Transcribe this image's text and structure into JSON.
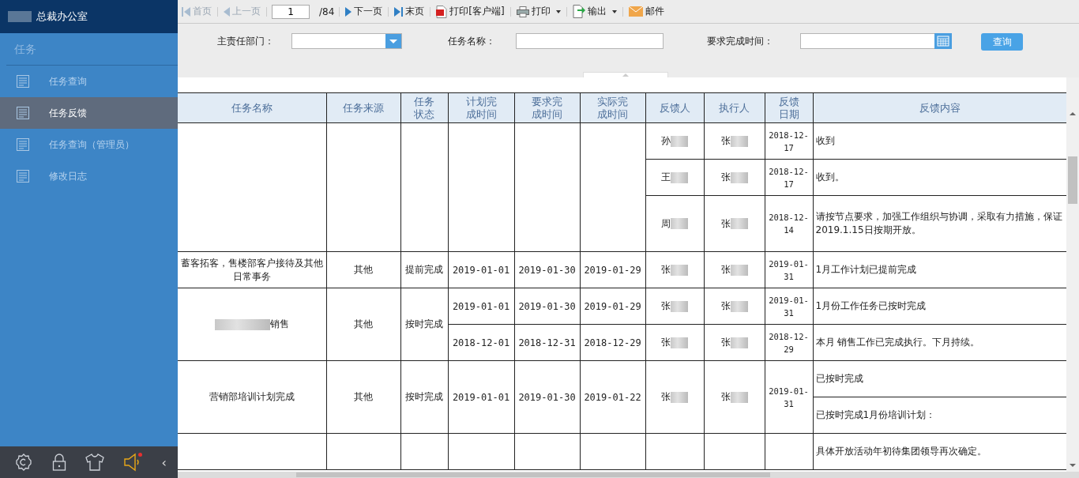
{
  "sidebar": {
    "header": {
      "title": "总裁办公室",
      "redacted": true
    },
    "section": "任务",
    "items": [
      {
        "label": "任务查询",
        "selected": false
      },
      {
        "label": "任务反馈",
        "selected": true
      },
      {
        "label": "任务查询（管理员）",
        "selected": false
      },
      {
        "label": "修改日志",
        "selected": false
      }
    ],
    "footer": {
      "collapse": "‹",
      "notification": true
    }
  },
  "toolbar": [
    {
      "kind": "first",
      "label": "首页",
      "disabled": true
    },
    {
      "kind": "prev",
      "label": "上一页",
      "disabled": true
    },
    {
      "kind": "page",
      "value": "1",
      "total": "/84"
    },
    {
      "kind": "next",
      "label": "下一页",
      "disabled": false
    },
    {
      "kind": "last",
      "label": "末页",
      "disabled": false
    },
    {
      "kind": "pdf",
      "label": "打印[客户端]"
    },
    {
      "kind": "print",
      "label": "打印",
      "dropdown": true
    },
    {
      "kind": "export",
      "label": "输出",
      "dropdown": true
    },
    {
      "kind": "mail",
      "label": "邮件"
    }
  ],
  "filters": [
    {
      "kind": "select",
      "label": "主责任部门："
    },
    {
      "kind": "text",
      "label": "任务名称："
    },
    {
      "kind": "date",
      "label": "要求完成时间："
    }
  ],
  "search_button": "查询",
  "table": {
    "columns": [
      "任务名称",
      "任务来源",
      "任务状态",
      "计划完成时间",
      "要求完成时间",
      "实际完成时间",
      "反馈人",
      "执行人",
      "反馈日期",
      "反馈内容"
    ],
    "tasks": [
      {
        "records": [
          {
            "feedbacks": [
              {
                "person": "孙",
                "executor": "张",
                "redacted": true,
                "date": "2018-12-17",
                "contents": [
                  "收到"
                ]
              },
              {
                "person": "王",
                "executor": "张",
                "redacted": true,
                "date": "2018-12-17",
                "contents": [
                  "收到。"
                ]
              },
              {
                "person": "周",
                "executor": "张",
                "redacted": true,
                "date": "2018-12-14",
                "contents": [
                  "请按节点要求，加强工作组织与协调，采取有力措施，保证2019.1.15日按期开放。"
                ]
              }
            ]
          }
        ]
      },
      {
        "name": "蓄客拓客，售楼部客户接待及其他日常事务",
        "source": "其他",
        "status": "提前完成",
        "records": [
          {
            "plan": "2019-01-01",
            "required": "2019-01-30",
            "actual": "2019-01-29",
            "feedbacks": [
              {
                "person": "张",
                "executor": "张",
                "redacted": true,
                "date": "2019-01-31",
                "contents": [
                  "1月工作计划已提前完成"
                ]
              }
            ]
          }
        ]
      },
      {
        "name": "销售",
        "redacted": true,
        "source": "其他",
        "status": "按时完成",
        "records": [
          {
            "plan": "2019-01-01",
            "required": "2019-01-30",
            "actual": "2019-01-29",
            "feedbacks": [
              {
                "person": "张",
                "executor": "张",
                "redacted": true,
                "date": "2019-01-31",
                "contents": [
                  "1月份工作任务已按时完成"
                ]
              }
            ]
          },
          {
            "plan": "2018-12-01",
            "required": "2018-12-31",
            "actual": "2018-12-29",
            "feedbacks": [
              {
                "person": "张",
                "executor": "张",
                "redacted": true,
                "date": "2018-12-29",
                "contents": [
                  "本月 销售工作已完成执行。下月持续。"
                ]
              }
            ]
          }
        ]
      },
      {
        "name": "营销部培训计划完成",
        "source": "其他",
        "status": "按时完成",
        "records": [
          {
            "plan": "2019-01-01",
            "required": "2019-01-30",
            "actual": "2019-01-22",
            "feedbacks": [
              {
                "person": "张",
                "executor": "张",
                "redacted": true,
                "date": "2019-01-31",
                "contents": [
                  "已按时完成",
                  "已按时完成1月份培训计划："
                ]
              }
            ]
          }
        ]
      },
      {
        "records": [
          {
            "feedbacks": [
              {
                "contents": [
                  "具体开放活动年初待集团领导再次确定。"
                ]
              }
            ]
          }
        ]
      }
    ]
  }
}
